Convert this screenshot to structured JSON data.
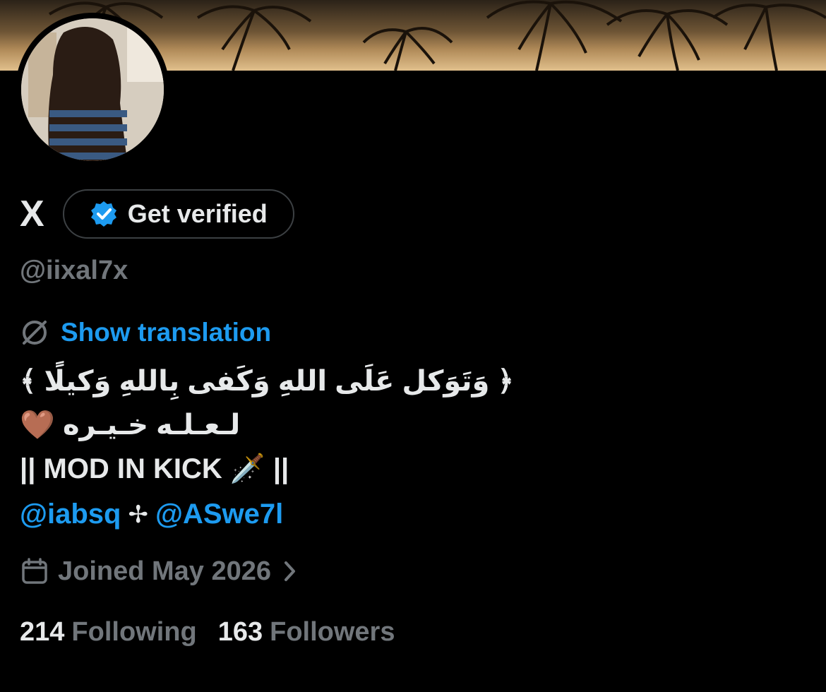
{
  "profile": {
    "display_name": "X",
    "handle": "@iixal7x",
    "verify_button_label": "Get verified",
    "translate_label": "Show translation",
    "bio_line1": "﴿ وَتَوَكل عَلَى اللهِ وَكَفى بِاللهِ وَكيلًا ﴾",
    "bio_line2": "لـعـلـه خـيـره",
    "bio_line2_emoji": "🤎",
    "bio_line3": "|| MOD IN KICK 🗡️ ||",
    "mention1": "@iabsq",
    "mention_separator": "✢",
    "mention2": "@ASwe7l",
    "joined": "Joined May 2026",
    "following_count": "214",
    "following_label": "Following",
    "followers_count": "163",
    "followers_label": "Followers"
  },
  "icons": {
    "verified": "verified-badge-icon",
    "translate": "translate-globe-icon",
    "calendar": "calendar-icon",
    "chevron": "chevron-right-icon"
  },
  "colors": {
    "background": "#000000",
    "text_primary": "#e7e9ea",
    "text_secondary": "#71767b",
    "accent": "#1d9bf0"
  }
}
